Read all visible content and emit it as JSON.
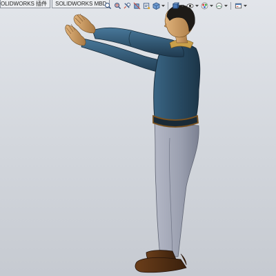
{
  "tabs": [
    {
      "label": "OLIDWORKS 插件"
    },
    {
      "label": "SOLIDWORKS MBD"
    }
  ],
  "toolbar": {
    "icons": [
      "zoom-to-fit-icon",
      "zoom-area-icon",
      "previous-view-icon",
      "section-view-icon",
      "dynamic-annotation-icon",
      "view-orientation-icon",
      "display-style-icon",
      "hide-show-items-icon",
      "edit-appearance-icon",
      "apply-scene-icon",
      "view-settings-icon"
    ]
  },
  "colors": {
    "background_top": "#e2e5ea",
    "background_bottom": "#c6cad1",
    "shirt": "#2c4d63",
    "trousers": "#9a9faf",
    "skin": "#c99a62",
    "hair": "#1e1b18",
    "shoes": "#4a2a12",
    "belt": "#7a5220"
  },
  "model": {
    "name_icon": "human-mannequin-model"
  }
}
